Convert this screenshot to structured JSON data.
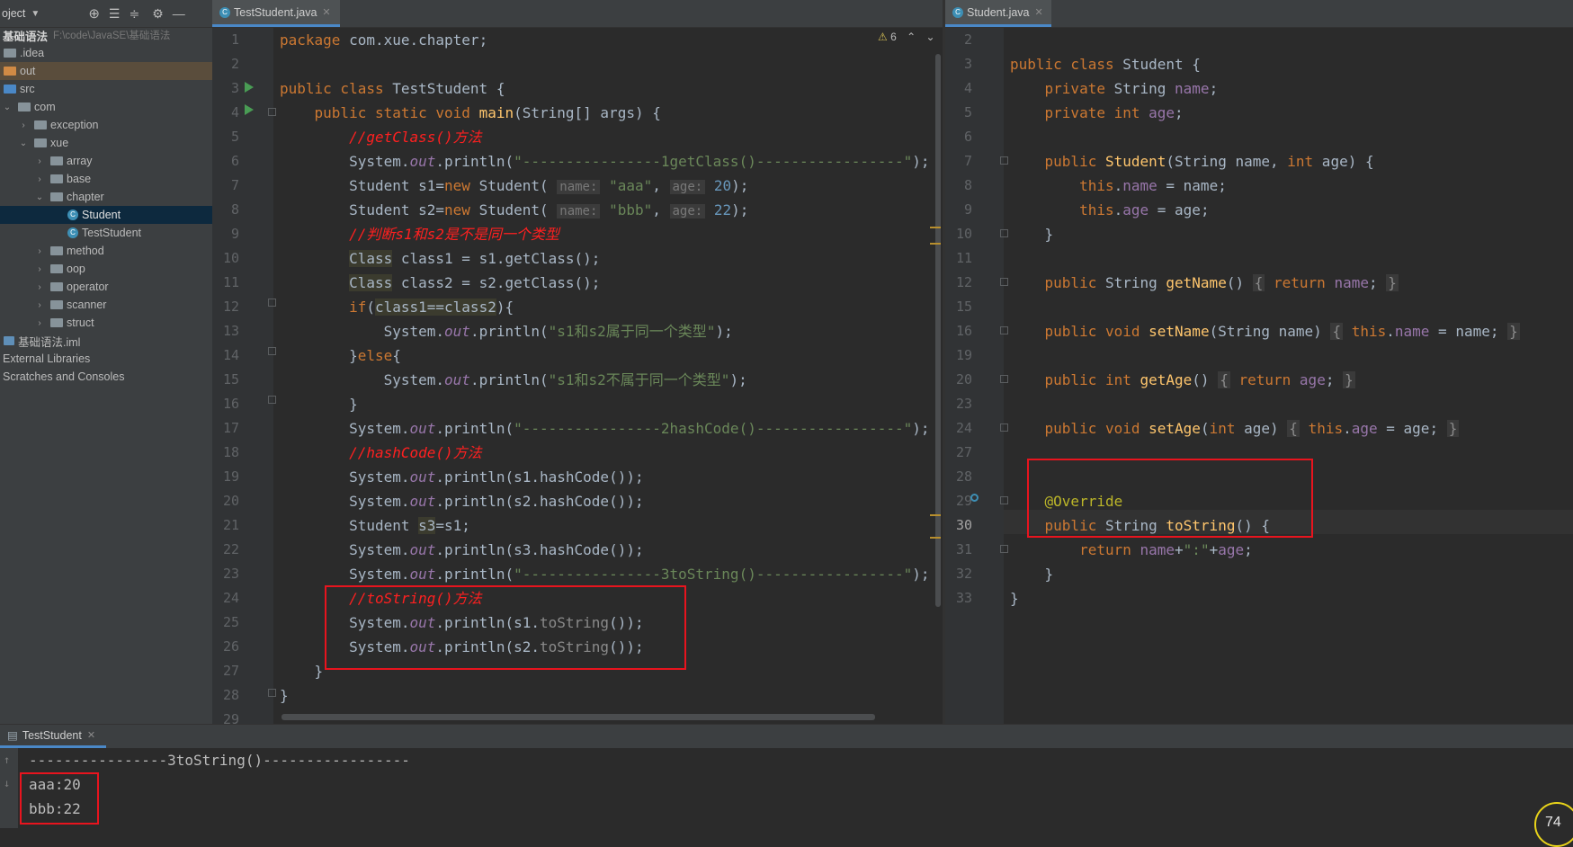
{
  "sidebar": {
    "header_title": "oject",
    "root_name": "基础语法",
    "root_path": "F:\\code\\JavaSE\\基础语法",
    "items": [
      {
        "label": ".idea"
      },
      {
        "label": "out"
      },
      {
        "label": "src"
      },
      {
        "label": "com"
      },
      {
        "label": "exception"
      },
      {
        "label": "xue"
      },
      {
        "label": "array"
      },
      {
        "label": "base"
      },
      {
        "label": "chapter"
      },
      {
        "label": "Student"
      },
      {
        "label": "TestStudent"
      },
      {
        "label": "method"
      },
      {
        "label": "oop"
      },
      {
        "label": "operator"
      },
      {
        "label": "scanner"
      },
      {
        "label": "struct"
      },
      {
        "label": "基础语法.iml"
      },
      {
        "label": "External Libraries"
      },
      {
        "label": "Scratches and Consoles"
      }
    ]
  },
  "left_editor": {
    "tab_label": "TestStudent.java",
    "warning_count": "6",
    "line_numbers": [
      "1",
      "2",
      "3",
      "4",
      "5",
      "6",
      "7",
      "8",
      "9",
      "10",
      "11",
      "12",
      "13",
      "14",
      "15",
      "16",
      "17",
      "18",
      "19",
      "20",
      "21",
      "22",
      "23",
      "24",
      "25",
      "26",
      "27",
      "28",
      "29"
    ]
  },
  "right_editor": {
    "tab_label": "Student.java",
    "line_numbers": [
      "2",
      "3",
      "4",
      "5",
      "6",
      "7",
      "8",
      "9",
      "10",
      "11",
      "12",
      "15",
      "16",
      "19",
      "20",
      "23",
      "24",
      "27",
      "28",
      "29",
      "30",
      "31",
      "32",
      "33"
    ]
  },
  "run_panel": {
    "tab_label": "TestStudent",
    "output": [
      "----------------3toString()-----------------",
      "aaa:20",
      "bbb:22"
    ],
    "badge": "74"
  }
}
